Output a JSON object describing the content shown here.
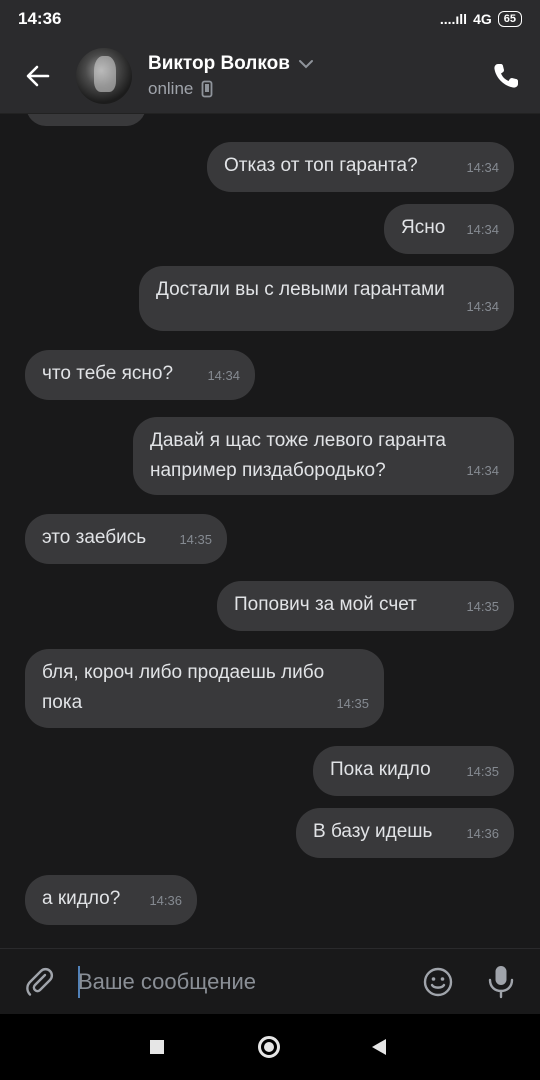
{
  "status_bar": {
    "time": "14:36",
    "signal": "....ıll",
    "network": "4G",
    "battery": "65"
  },
  "header": {
    "name": "Виктор Волков",
    "status": "online"
  },
  "messages": [
    {
      "side": "right",
      "text": "Отказ от топ гаранта?",
      "time": "14:34"
    },
    {
      "side": "right",
      "text": "Ясно",
      "time": "14:34"
    },
    {
      "side": "right",
      "text": "Достали вы с левыми гарантами",
      "time": "14:34"
    },
    {
      "side": "left",
      "text": "что тебе ясно?",
      "time": "14:34"
    },
    {
      "side": "right",
      "text": "Давай я щас тоже левого гаранта\nнапример пиздабородько?",
      "time": "14:34"
    },
    {
      "side": "left",
      "text": "это заебись",
      "time": "14:35"
    },
    {
      "side": "right",
      "text": "Попович за мой счет",
      "time": "14:35"
    },
    {
      "side": "left",
      "text": "бля, короч либо продаешь либо\nпока",
      "time": "14:35"
    },
    {
      "side": "right",
      "text": "Пока кидло",
      "time": "14:35"
    },
    {
      "side": "right",
      "text": "В базу идешь",
      "time": "14:36"
    },
    {
      "side": "left",
      "text": "а кидло?",
      "time": "14:36"
    }
  ],
  "composer": {
    "placeholder": "Ваше сообщение"
  },
  "icons": {
    "back": "arrow-left-icon",
    "chevron": "chevron-down-icon",
    "device": "mobile-device-icon",
    "call": "phone-icon",
    "attach": "paperclip-icon",
    "emoji": "smile-icon",
    "mic": "microphone-icon"
  },
  "colors": {
    "bubble": "#39393b",
    "background": "#19191a",
    "header": "#2b2b2d",
    "accent": "#5181b8"
  }
}
